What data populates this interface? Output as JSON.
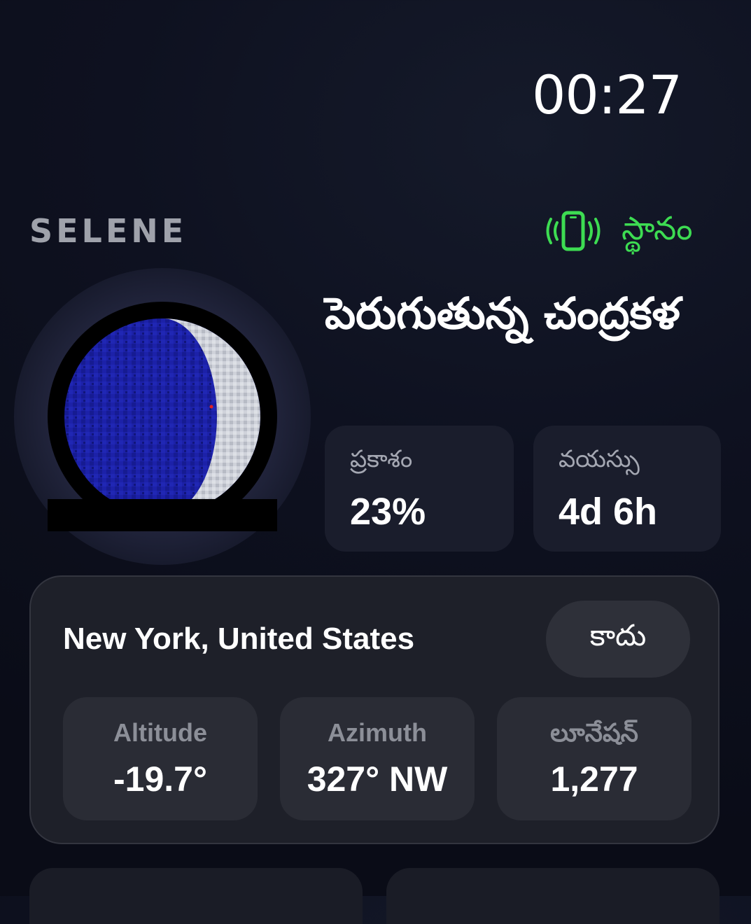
{
  "status_bar": {
    "time": "00:27"
  },
  "header": {
    "app_name": "SELENE",
    "location_status": {
      "label": "స్థానం",
      "icon": "phone-vibrate-icon",
      "color": "#3ddc52"
    }
  },
  "moon": {
    "phase_name": "పెరుగుతున్న చంద్రకళ",
    "illumination": {
      "label": "ప్రకాశం",
      "value": "23%"
    },
    "age": {
      "label": "వయస్సు",
      "value": "4d 6h"
    }
  },
  "location_panel": {
    "name": "New York, United States",
    "toggle_label": "కాదు",
    "metrics": [
      {
        "label": "Altitude",
        "value": "-19.7°"
      },
      {
        "label": "Azimuth",
        "value": "327° NW"
      },
      {
        "label": "లూనేషన్",
        "value": "1,277"
      }
    ]
  },
  "colors": {
    "background": "#0e1120",
    "accent_green": "#3ddc52",
    "moon_shadow": "#1a1f9e",
    "moon_lit": "#c9ccd4"
  }
}
